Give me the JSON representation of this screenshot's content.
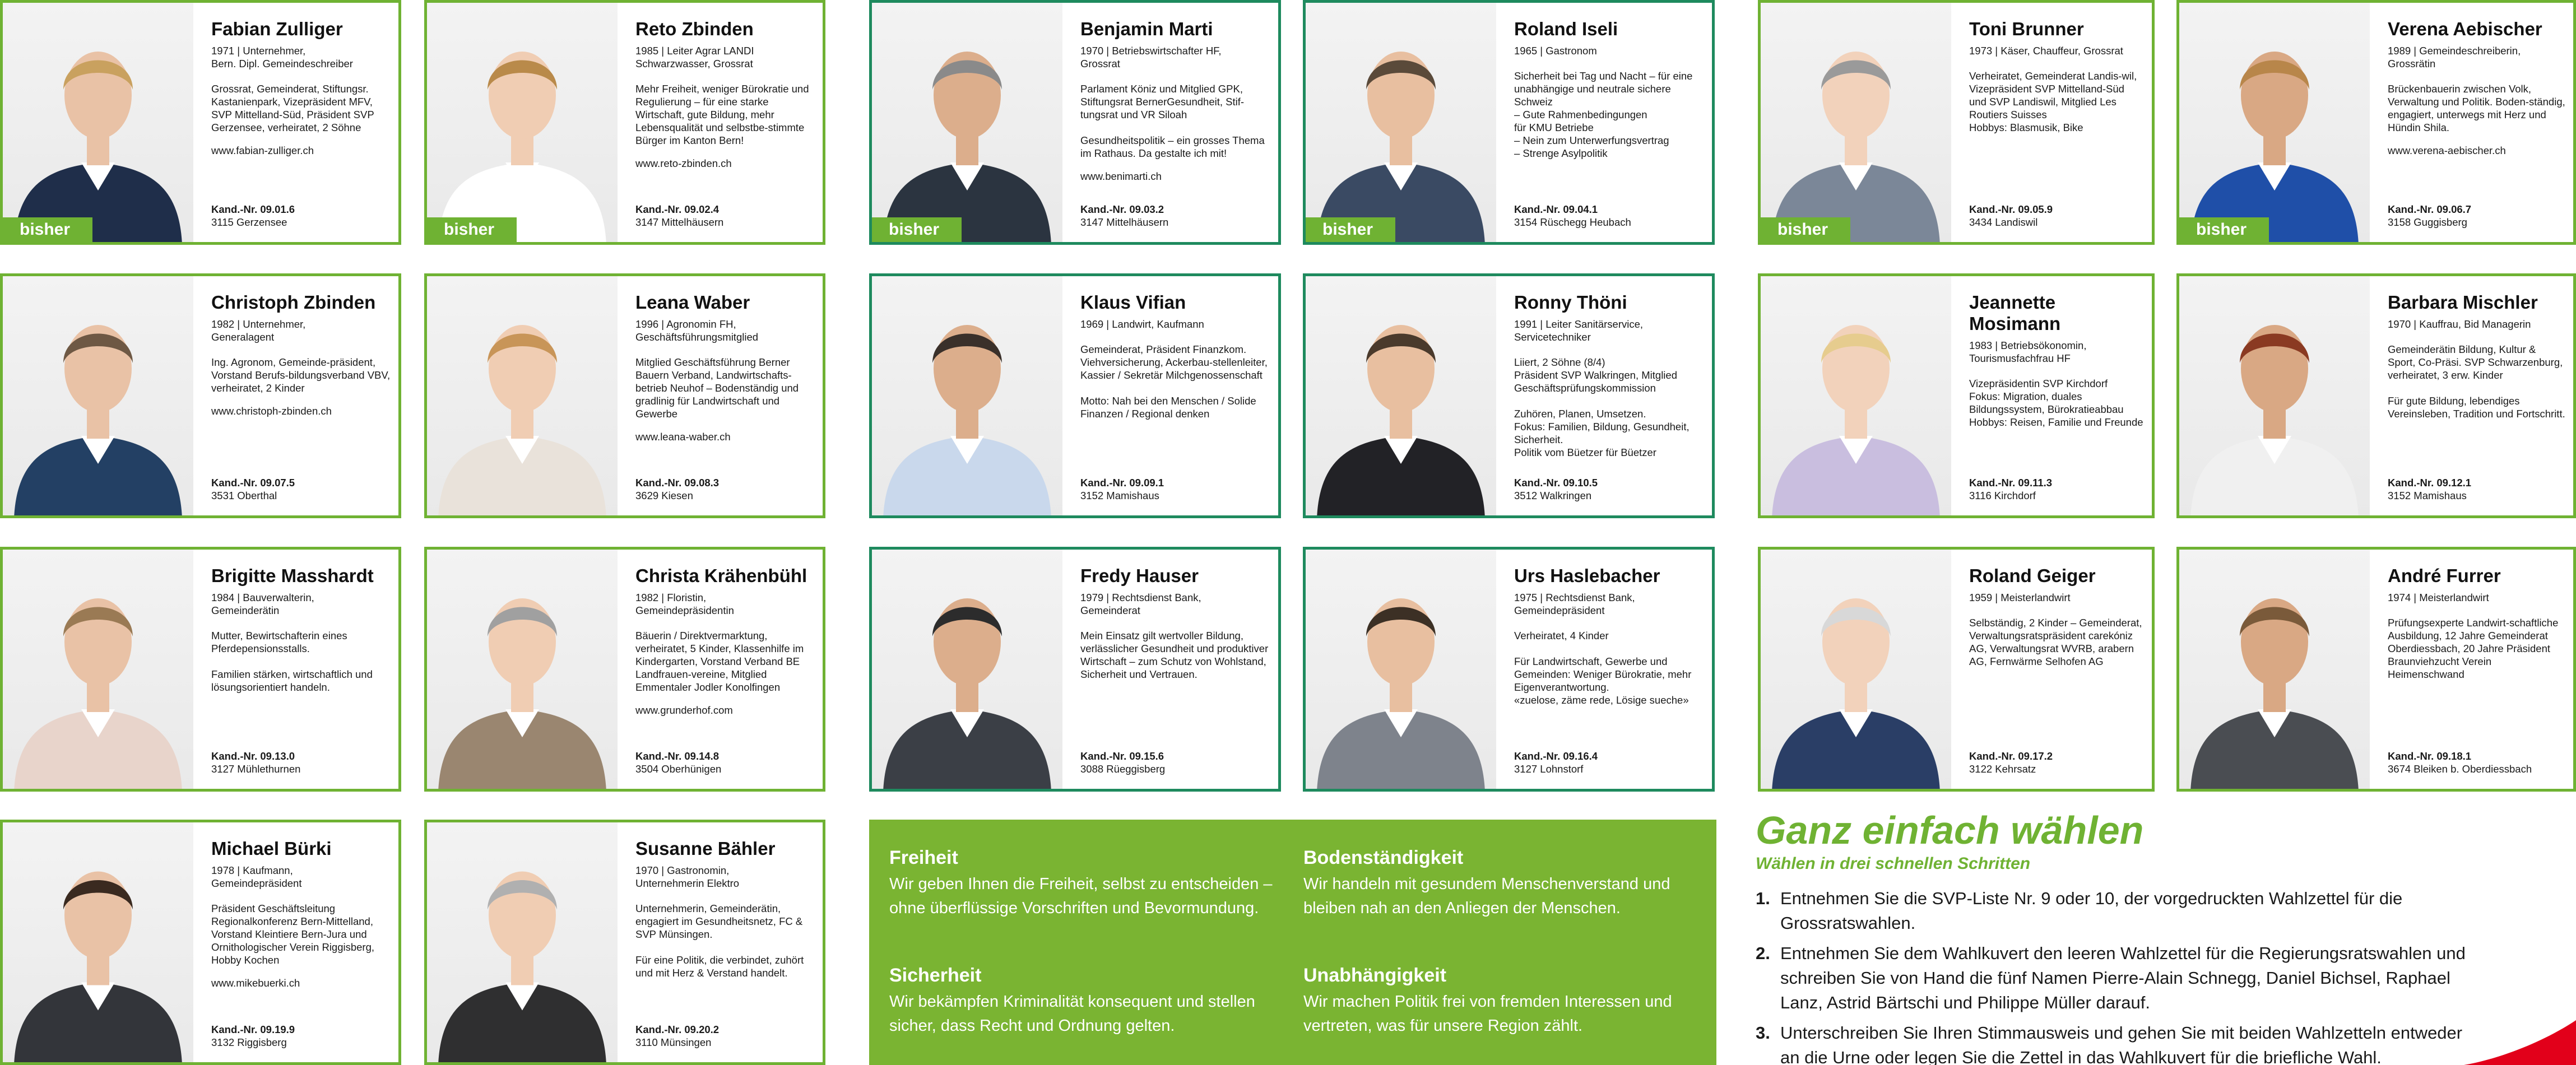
{
  "candidates": [
    {
      "name": "Fabian Zulliger",
      "meta": "1971 | Unternehmer,\nBern. Dipl. Gemeindeschreiber",
      "desc": "Grossrat, Gemeinderat, Stiftungsr. Kastanienpark, Vizepräsident MFV, SVP Mittelland-Süd, Präsident SVP Gerzensee, verheiratet, 2 Söhne",
      "web": "www.fabian-zulliger.ch",
      "kand": "09.01.6",
      "place": "3115 Gerzensee",
      "badge": "bisher"
    },
    {
      "name": "Reto Zbinden",
      "meta": "1985 | Leiter Agrar LANDI\nSchwarzwasser, Grossrat",
      "desc": "Mehr Freiheit, weniger Bürokratie und Regulierung – für eine starke Wirtschaft, gute Bildung, mehr Lebensqualität und selbstbe-stimmte Bürger im Kanton Bern!",
      "web": "www.reto-zbinden.ch",
      "kand": "09.02.4",
      "place": "3147 Mittelhäusern",
      "badge": "bisher"
    },
    {
      "name": "Benjamin Marti",
      "meta": "1970 | Betriebswirtschafter HF,\nGrossrat",
      "desc": "Parlament Köniz und Mitglied GPK, Stiftungsrat BernerGesundheit, Stif-tungsrat und VR Siloah\n\nGesundheitspolitik – ein grosses Thema im Rathaus. Da gestalte ich mit!",
      "web": "www.benimarti.ch",
      "kand": "09.03.2",
      "place": "3147 Mittelhäusern",
      "badge": "bisher"
    },
    {
      "name": "Roland Iseli",
      "meta": "1965 | Gastronom",
      "desc": "Sicherheit bei Tag und Nacht – für eine unabhängige und neutrale sichere Schweiz\n– Gute Rahmenbedingungen\n   für KMU Betriebe\n– Nein zum Unterwerfungsvertrag\n– Strenge Asylpolitik",
      "web": "",
      "kand": "09.04.1",
      "place": "3154 Rüschegg Heubach",
      "badge": "bisher"
    },
    {
      "name": "Toni Brunner",
      "meta": "1973 | Käser, Chauffeur, Grossrat",
      "desc": "Verheiratet, Gemeinderat Landis-wil, Vizepräsident SVP Mittelland-Süd und SVP Landiswil, Mitglied Les Routiers Suisses\nHobbys: Blasmusik, Bike",
      "web": "",
      "kand": "09.05.9",
      "place": "3434 Landiswil",
      "badge": "bisher"
    },
    {
      "name": "Verena Aebischer",
      "meta": "1989 | Gemeindeschreiberin,\nGrossrätin",
      "desc": "Brückenbauerin zwischen Volk, Verwaltung und Politik. Boden-ständig, engagiert, unterwegs mit Herz und Hündin Shila.",
      "web": "www.verena-aebischer.ch",
      "kand": "09.06.7",
      "place": "3158 Guggisberg",
      "badge": "bisher"
    },
    {
      "name": "Christoph Zbinden",
      "meta": "1982 | Unternehmer,\nGeneralagent",
      "desc": "Ing. Agronom, Gemeinde-präsident, Vorstand Berufs-bildungsverband VBV, verheiratet, 2 Kinder",
      "web": "www.christoph-zbinden.ch",
      "kand": "09.07.5",
      "place": "3531 Oberthal",
      "badge": ""
    },
    {
      "name": "Leana Waber",
      "meta": "1996 | Agronomin FH,\nGeschäftsführungsmitglied",
      "desc": "Mitglied Geschäftsführung Berner Bauern Verband, Landwirtschafts-betrieb Neuhof – Bodenständig und gradlinig für Landwirtschaft und Gewerbe",
      "web": "www.leana-waber.ch",
      "kand": "09.08.3",
      "place": "3629 Kiesen",
      "badge": ""
    },
    {
      "name": "Klaus Vifian",
      "meta": "1969 | Landwirt, Kaufmann",
      "desc": "Gemeinderat, Präsident Finanzkom. Viehversicherung, Ackerbau-stellenleiter, Kassier / Sekretär Milchgenossenschaft\n\nMotto: Nah bei den Menschen / Solide Finanzen / Regional denken",
      "web": "",
      "kand": "09.09.1",
      "place": "3152 Mamishaus",
      "badge": ""
    },
    {
      "name": "Ronny Thöni",
      "meta": "1991 | Leiter Sanitärservice,\nServicetechniker",
      "desc": "Liiert, 2 Söhne (8/4)\nPräsident SVP Walkringen, Mitglied Geschäftsprüfungskommission\n\nZuhören, Planen, Umsetzen.\nFokus: Familien, Bildung, Gesundheit, Sicherheit.\nPolitik vom Büetzer für Büetzer",
      "web": "",
      "kand": "09.10.5",
      "place": "3512 Walkringen",
      "badge": ""
    },
    {
      "name": "Jeannette\nMosimann",
      "meta": "1983 | Betriebsökonomin,\nTourismusfachfrau HF",
      "desc": "Vizepräsidentin SVP Kirchdorf\nFokus: Migration, duales Bildungssystem, Bürokratieabbau\nHobbys: Reisen, Familie und Freunde",
      "web": "",
      "kand": "09.11.3",
      "place": "3116 Kirchdorf",
      "badge": ""
    },
    {
      "name": "Barbara Mischler",
      "meta": "1970 | Kauffrau, Bid Managerin",
      "desc": "Gemeinderätin Bildung, Kultur & Sport, Co-Präsi. SVP Schwarzenburg, verheiratet, 3 erw. Kinder\n\nFür gute Bildung, lebendiges Vereinsleben, Tradition und Fortschritt.",
      "web": "",
      "kand": "09.12.1",
      "place": "3152 Mamishaus",
      "badge": ""
    },
    {
      "name": "Brigitte Masshardt",
      "meta": "1984 | Bauverwalterin,\nGemeinderätin",
      "desc": "Mutter, Bewirtschafterin eines Pferdepensionsstalls.\n\nFamilien stärken, wirtschaftlich und lösungsorientiert handeln.",
      "web": "",
      "kand": "09.13.0",
      "place": "3127 Mühlethurnen",
      "badge": ""
    },
    {
      "name": "Christa Krähenbühl",
      "meta": "1982 | Floristin,\nGemeindepräsidentin",
      "desc": "Bäuerin / Direktvermarktung, verheiratet, 5 Kinder, Klassenhilfe im Kindergarten, Vorstand Verband BE Landfrauen-vereine, Mitglied Emmentaler Jodler Konolfingen",
      "web": "www.grunderhof.com",
      "kand": "09.14.8",
      "place": "3504 Oberhünigen",
      "badge": ""
    },
    {
      "name": "Fredy Hauser",
      "meta": "1979 | Rechtsdienst Bank,\nGemeinderat",
      "desc": "Mein Einsatz gilt wertvoller Bildung, verlässlicher Gesundheit und produktiver Wirtschaft – zum Schutz von Wohlstand, Sicherheit und Vertrauen.",
      "web": "",
      "kand": "09.15.6",
      "place": "3088 Rüeggisberg",
      "badge": ""
    },
    {
      "name": "Urs Haslebacher",
      "meta": "1975 | Rechtsdienst Bank,\nGemeindepräsident",
      "desc": "Verheiratet, 4 Kinder\n\nFür Landwirtschaft, Gewerbe und Gemeinden: Weniger Bürokratie, mehr Eigenverantwortung.\n«zuelose, zäme rede, Lösige sueche»",
      "web": "",
      "kand": "09.16.4",
      "place": "3127 Lohnstorf",
      "badge": ""
    },
    {
      "name": "Roland Geiger",
      "meta": "1959 | Meisterlandwirt",
      "desc": "Selbständig, 2 Kinder – Gemeinderat, Verwaltungsratspräsident carekóniz AG, Verwaltungsrat WVRB, arabern AG, Fernwärme Selhofen AG",
      "web": "",
      "kand": "09.17.2",
      "place": "3122 Kehrsatz",
      "badge": ""
    },
    {
      "name": "André Furrer",
      "meta": "1974 | Meisterlandwirt",
      "desc": "Prüfungsexperte Landwirt-schaftliche Ausbildung, 12 Jahre Gemeinderat Oberdiessbach, 20 Jahre Präsident Braunviehzucht Verein Heimenschwand",
      "web": "",
      "kand": "09.18.1",
      "place": "3674 Bleiken b. Oberdiessbach",
      "badge": ""
    },
    {
      "name": "Michael Bürki",
      "meta": "1978 | Kaufmann,\nGemeindepräsident",
      "desc": "Präsident Geschäftsleitung Regionalkonferenz Bern-Mittelland, Vorstand Kleintiere Bern-Jura und Ornithologischer Verein Riggisberg, Hobby Kochen",
      "web": "www.mikebuerki.ch",
      "kand": "09.19.9",
      "place": "3132 Riggisberg",
      "badge": ""
    },
    {
      "name": "Susanne Bähler",
      "meta": "1970 | Gastronomin,\nUnternehmerin Elektro",
      "desc": "Unternehmerin, Gemeinderätin, engagiert im Gesundheitsnetz, FC & SVP Münsingen.\n\nFür eine Politik, die verbindet, zuhört und mit Herz & Verstand handelt.",
      "web": "",
      "kand": "09.20.2",
      "place": "3110 Münsingen",
      "badge": ""
    }
  ],
  "kand_label": "Kand.-Nr.",
  "values": [
    {
      "title": "Freiheit",
      "text": "Wir geben Ihnen die Freiheit, selbst zu entscheiden – ohne überflüssige Vorschriften und Bevormundung."
    },
    {
      "title": "Bodenständigkeit",
      "text": "Wir handeln mit gesundem Menschenverstand und bleiben nah an den Anliegen der Menschen."
    },
    {
      "title": "Sicherheit",
      "text": "Wir bekämpfen Kriminalität konsequent und stellen sicher, dass Recht und Ordnung gelten."
    },
    {
      "title": "Unabhängigkeit",
      "text": "Wir machen Politik frei von fremden Interessen und vertreten, was für unsere Region zählt."
    }
  ],
  "howto": {
    "title": "Ganz einfach wählen",
    "subtitle": "Wählen in drei schnellen Schritten",
    "steps": [
      {
        "num": "1.",
        "text": "Entnehmen Sie die SVP-Liste Nr. 9 oder 10, der vorgedruckten Wahlzettel für die Grossratswahlen."
      },
      {
        "num": "2.",
        "text": "Entnehmen Sie dem Wahlkuvert den leeren Wahlzettel für die Regierungsratswahlen und schreiben Sie von Hand die fünf Namen Pierre-Alain Schnegg, Daniel Bichsel, Raphael Lanz, Astrid Bärtschi und Philippe Müller darauf."
      },
      {
        "num": "3.",
        "text": "Unterschreiben Sie Ihren Stimmausweis und gehen Sie mit beiden Wahlzetteln entweder an die Urne oder legen Sie die Zettel in das Wahlkuvert für die briefliche Wahl."
      }
    ]
  },
  "colors": {
    "accent": "#6fb233",
    "border_dark": "#1e8a5e",
    "panel": "#7ab432",
    "red": "#e2001a"
  }
}
